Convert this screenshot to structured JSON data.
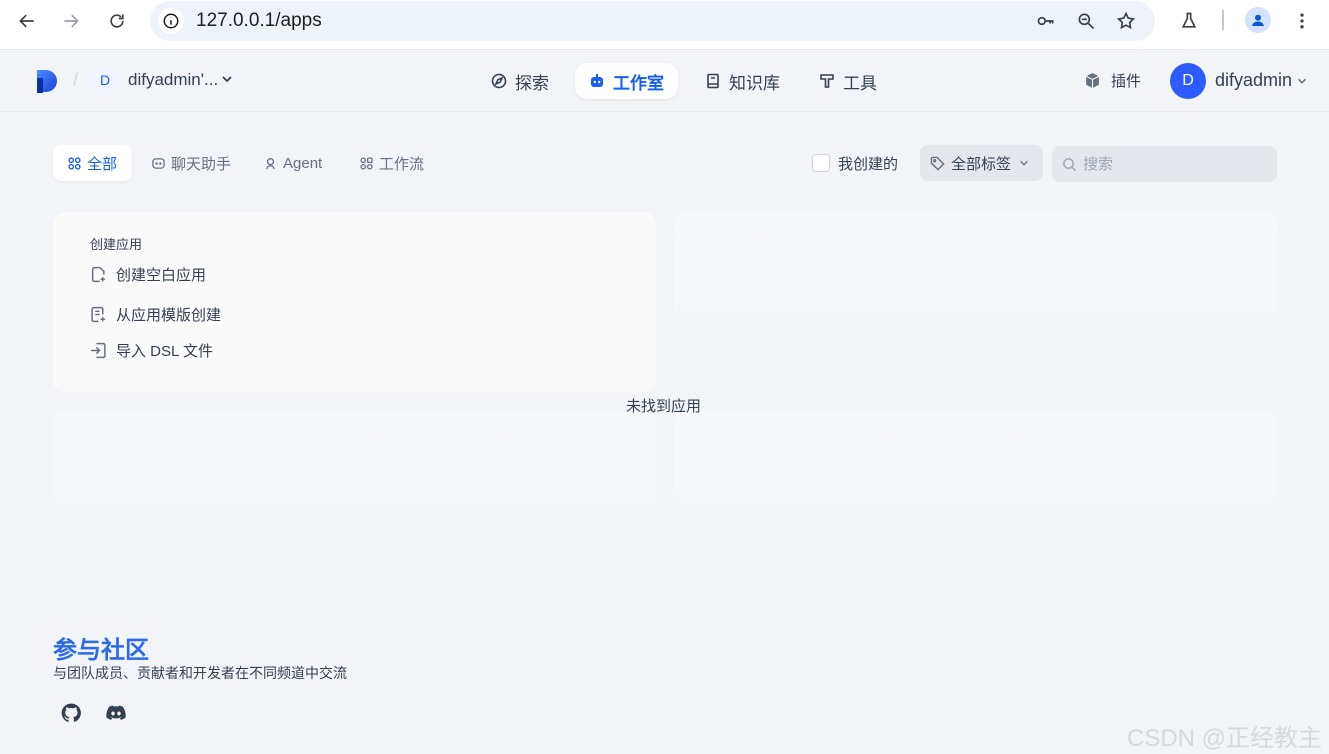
{
  "browser": {
    "url": "127.0.0.1/apps"
  },
  "header": {
    "workspace_initial": "D",
    "workspace_name": "difyadmin'...",
    "nav": [
      {
        "label": "探索",
        "icon": "compass-icon"
      },
      {
        "label": "工作室",
        "icon": "robot-icon"
      },
      {
        "label": "知识库",
        "icon": "book-icon"
      },
      {
        "label": "工具",
        "icon": "hammer-icon"
      }
    ],
    "plugin_label": "插件",
    "user_initial": "D",
    "user_name": "difyadmin"
  },
  "tabs": [
    {
      "label": "全部",
      "icon": "grid-icon",
      "active": true
    },
    {
      "label": "聊天助手",
      "icon": "chat-icon",
      "active": false
    },
    {
      "label": "Agent",
      "icon": "agent-icon",
      "active": false
    },
    {
      "label": "工作流",
      "icon": "workflow-icon",
      "active": false
    }
  ],
  "filters": {
    "mine_label": "我创建的",
    "tag_label": "全部标签",
    "search_placeholder": "搜索"
  },
  "create_card": {
    "title": "创建应用",
    "options": [
      {
        "label": "创建空白应用",
        "icon": "file-plus-icon"
      },
      {
        "label": "从应用模版创建",
        "icon": "template-icon"
      },
      {
        "label": "导入 DSL 文件",
        "icon": "import-icon"
      }
    ]
  },
  "empty_text": "未找到应用",
  "footer": {
    "title": "参与社区",
    "description": "与团队成员、贡献者和开发者在不同频道中交流"
  },
  "watermark": "CSDN @正经教主",
  "colors": {
    "accent": "#155eef",
    "footer_title": "#2b6ae8",
    "page_bg": "#f2f4f7"
  }
}
